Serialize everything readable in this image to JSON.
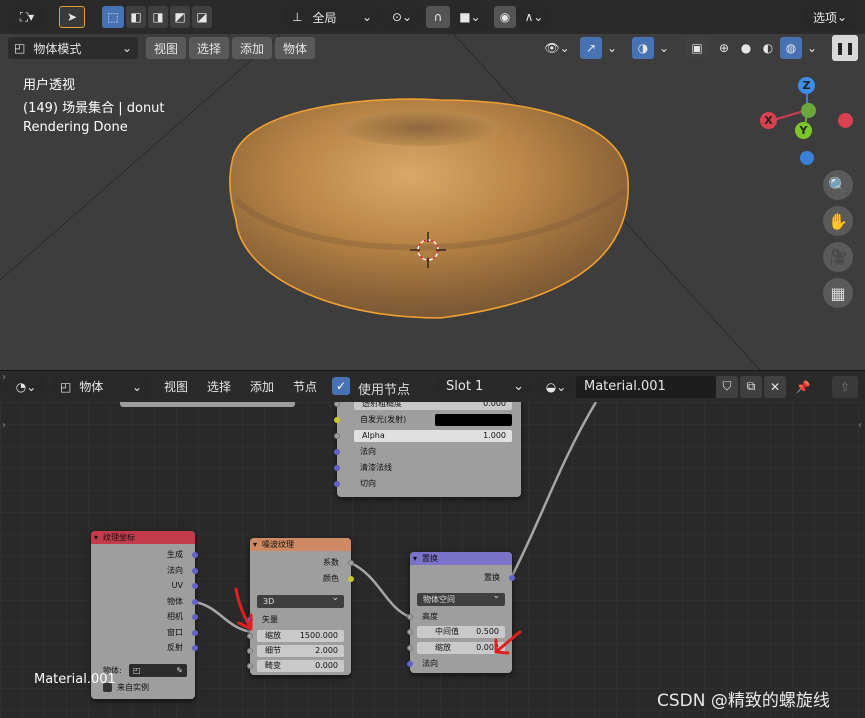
{
  "viewport": {
    "header": {
      "transform_orientation": "全局",
      "options_label": "选项"
    },
    "mode_bar": {
      "mode_label": "物体模式",
      "menus": [
        "视图",
        "选择",
        "添加",
        "物体"
      ]
    },
    "overlay": {
      "view_name": "用户透视",
      "collection": "(149) 场景集合 | donut",
      "status": "Rendering Done"
    },
    "gizmo": {
      "z": "Z",
      "y": "Y",
      "x": "X"
    }
  },
  "node_editor": {
    "header": {
      "object_label": "物体",
      "menus": [
        "视图",
        "选择",
        "添加",
        "节点"
      ],
      "use_nodes_label": "使用节点",
      "slot_label": "Slot 1",
      "material_name": "Material.001"
    },
    "bsdf_partial": {
      "rows": [
        {
          "label": "透射粗糙度",
          "value": "0.000"
        },
        {
          "label": "自发光(发射)"
        },
        {
          "label": "Alpha",
          "value": "1.000"
        },
        {
          "label": "法向"
        },
        {
          "label": "清漆法线"
        },
        {
          "label": "切向"
        }
      ]
    },
    "tex_coord": {
      "title": "纹理坐标",
      "outputs": [
        "生成",
        "法向",
        "UV",
        "物体",
        "相机",
        "窗口",
        "反射"
      ],
      "object_label": "物体:",
      "from_instancer": "来自实例"
    },
    "noise": {
      "title": "噪波纹理",
      "outputs": [
        "系数",
        "颜色"
      ],
      "dimension": "3D",
      "vector_label": "矢量",
      "scale_label": "缩放",
      "scale_value": "1500.000",
      "detail_label": "细节",
      "detail_value": "2.000",
      "distortion_label": "畸变",
      "distortion_value": "0.000"
    },
    "displacement": {
      "title": "置换",
      "output": "置换",
      "space": "物体空间",
      "height_label": "高度",
      "midlevel_label": "中间值",
      "midlevel_value": "0.500",
      "scale_label": "缩放",
      "scale_value": "0.002",
      "normal_label": "法向"
    },
    "footer_material": "Material.001"
  },
  "watermark": "CSDN @精致的螺旋线",
  "colors": {
    "accent": "#4772b3",
    "donut_outline": "#f0a030",
    "tex_coord_header": "#c23b4b",
    "noise_header": "#cf8a63",
    "displacement_header": "#7b73c9",
    "annotation_arrow": "#e02020"
  }
}
